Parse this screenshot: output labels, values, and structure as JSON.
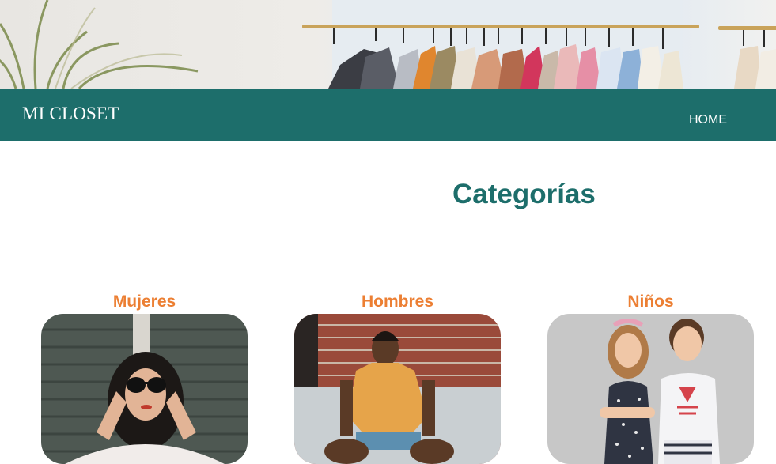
{
  "header": {
    "banner_image": "clothing-rack-photo",
    "brand": "MI CLOSET",
    "nav": [
      {
        "label": "HOME"
      }
    ]
  },
  "main": {
    "title": "Categorías",
    "categories": [
      {
        "label": "Mujeres",
        "image": "woman-in-sunglasses-photo"
      },
      {
        "label": "Hombres",
        "image": "man-sitting-by-brick-wall-photo"
      },
      {
        "label": "Niños",
        "image": "two-children-photo"
      }
    ]
  },
  "colors": {
    "nav_background": "#1d6e6b",
    "title": "#1d6e6b",
    "category_label": "#ec7f33",
    "background": "#ffffff"
  }
}
